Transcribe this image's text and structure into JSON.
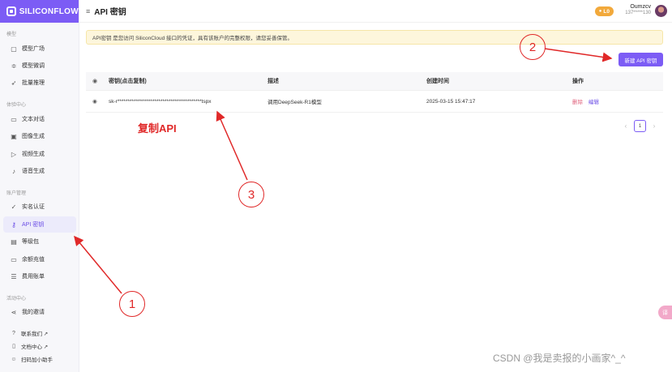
{
  "brand": {
    "name": "SILICONFLOW"
  },
  "sidebar": {
    "sections": [
      {
        "label": "模型",
        "items": [
          {
            "label": "模型广场",
            "icon": "cube-icon"
          },
          {
            "label": "模型微调",
            "icon": "sliders-icon"
          },
          {
            "label": "批量推理",
            "icon": "rocket-icon"
          }
        ]
      },
      {
        "label": "体验中心",
        "items": [
          {
            "label": "文本对话",
            "icon": "chat-icon"
          },
          {
            "label": "图像生成",
            "icon": "image-icon"
          },
          {
            "label": "视频生成",
            "icon": "video-icon"
          },
          {
            "label": "语音生成",
            "icon": "mic-icon"
          }
        ]
      },
      {
        "label": "账户管理",
        "items": [
          {
            "label": "实名认证",
            "icon": "user-check-icon"
          },
          {
            "label": "API 密钥",
            "icon": "key-icon",
            "active": true
          },
          {
            "label": "等级包",
            "icon": "package-icon"
          },
          {
            "label": "余额充值",
            "icon": "wallet-icon"
          },
          {
            "label": "费用账单",
            "icon": "bill-icon"
          }
        ]
      },
      {
        "label": "活动中心",
        "items": [
          {
            "label": "我的邀请",
            "icon": "share-icon"
          }
        ]
      }
    ],
    "footer": [
      {
        "label": "联系我们 ↗",
        "icon": "help-icon"
      },
      {
        "label": "文档中心 ↗",
        "icon": "doc-icon"
      },
      {
        "label": "扫码加小助手",
        "icon": "people-icon"
      }
    ]
  },
  "header": {
    "title": "API 密钥",
    "level": "L0",
    "user_name": "Oumzcv",
    "user_phone": "137*****130"
  },
  "notice": "API密钥 是您访问 SiliconCloud 接口的凭证，具有该账户的完整权限，请您妥善保管。",
  "new_key_label": "新建 API 密钥",
  "table": {
    "headers": {
      "key": "密钥(点击复制)",
      "desc": "描述",
      "created": "创建时间",
      "actions": "操作"
    },
    "rows": [
      {
        "key": "sk-r*****************************************tspx",
        "desc": "调用DeepSeek-R1模型",
        "created": "2025-03-15 15:47:17",
        "delete": "删除",
        "edit": "编辑"
      }
    ]
  },
  "pager": {
    "page": "1",
    "prev": "‹",
    "next": "›"
  },
  "annotations": {
    "copy_label": "复制API",
    "n1": "1",
    "n2": "2",
    "n3": "3",
    "color": "#e02828"
  },
  "float_button": "译",
  "watermark": "CSDN @我是卖报的小画家^_^",
  "colors": {
    "accent": "#7c5cf5",
    "notice_bg": "#fdf6dc",
    "level_badge": "#f2a93b",
    "danger": "#e0617c"
  }
}
